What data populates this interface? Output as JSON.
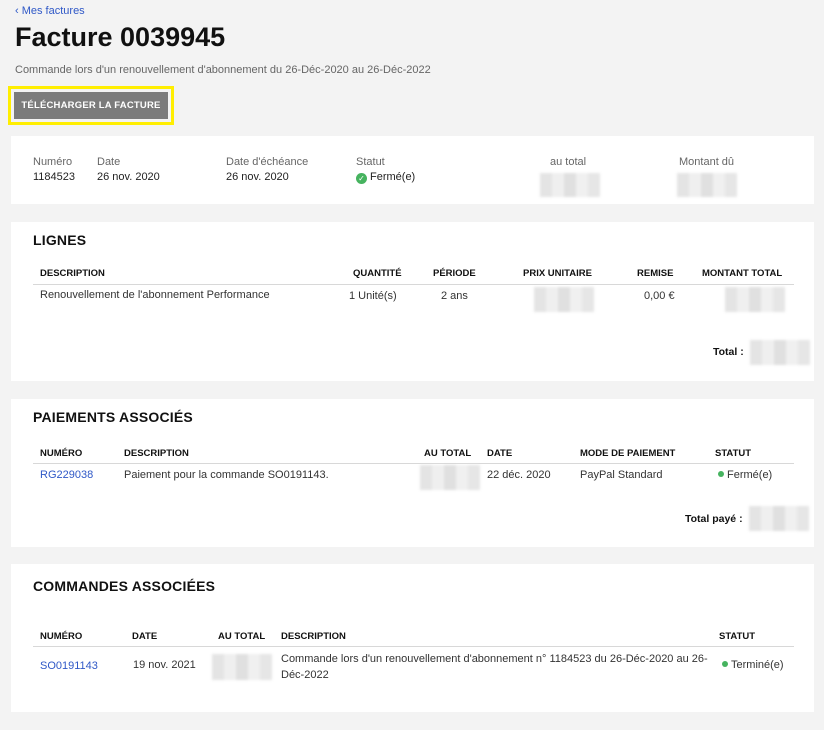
{
  "nav": {
    "back_label": "‹ Mes factures"
  },
  "page": {
    "title": "Facture 0039945",
    "subtitle": "Commande lors d'un renouvellement d'abonnement du 26-Déc-2020 au 26-Déc-2022",
    "download_label": "TÉLÉCHARGER LA FACTURE"
  },
  "summary": {
    "numero_label": "Numéro",
    "numero": "1184523",
    "date_label": "Date",
    "date": "26 nov. 2020",
    "echeance_label": "Date d'échéance",
    "echeance": "26 nov. 2020",
    "statut_label": "Statut",
    "statut": "Fermé(e)",
    "total_label": "au total",
    "du_label": "Montant dû"
  },
  "lignes": {
    "title": "LIGNES",
    "headers": [
      "DESCRIPTION",
      "QUANTITÉ",
      "PÉRIODE",
      "PRIX UNITAIRE",
      "REMISE",
      "MONTANT TOTAL"
    ],
    "rows": [
      {
        "description": "Renouvellement de l'abonnement Performance",
        "quantite": "1 Unité(s)",
        "periode": "2 ans",
        "remise": "0,00 €"
      }
    ],
    "total_label": "Total :"
  },
  "paiements": {
    "title": "PAIEMENTS ASSOCIÉS",
    "headers": [
      "NUMÉRO",
      "DESCRIPTION",
      "AU TOTAL",
      "DATE",
      "MODE DE PAIEMENT",
      "STATUT"
    ],
    "rows": [
      {
        "numero": "RG229038",
        "description": "Paiement pour la commande SO0191143.",
        "date": "22 déc. 2020",
        "mode": "PayPal Standard",
        "statut": "Fermé(e)"
      }
    ],
    "total_label": "Total payé :"
  },
  "commandes": {
    "title": "COMMANDES ASSOCIÉES",
    "headers": [
      "NUMÉRO",
      "DATE",
      "AU TOTAL",
      "DESCRIPTION",
      "STATUT"
    ],
    "rows": [
      {
        "numero": "SO0191143",
        "date": "19 nov. 2021",
        "description_l1": "Commande lors d'un renouvellement d'abonnement n° 1184523 du 26-Déc-2020 au 26-",
        "description_l2": "Déc-2022",
        "statut": "Terminé(e)"
      }
    ]
  },
  "colors": {
    "link": "#2f58c7",
    "status_green": "#46b35f",
    "highlight": "#ffee00",
    "button_bg": "#7b7b7b"
  },
  "icons": {
    "status_closed": "check-circle-icon",
    "status_dot": "green-dot-icon"
  }
}
